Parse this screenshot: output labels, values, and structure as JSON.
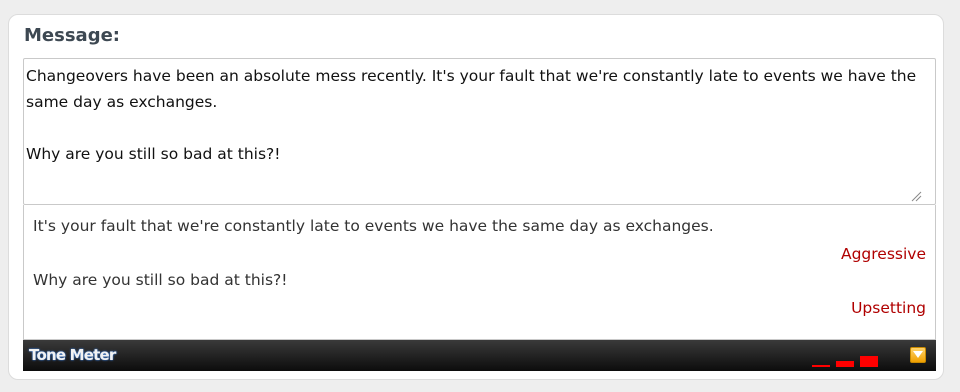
{
  "form": {
    "label": "Message:",
    "message_text": "Changeovers have been an absolute mess recently. It's your fault that we're constantly late to events we have the same day as exchanges.\n\nWhy are you still so bad at this?!"
  },
  "analysis": {
    "items": [
      {
        "sentence": "It's your fault that we're constantly late to events we have the same day as exchanges.",
        "tone": "Aggressive"
      },
      {
        "sentence": "Why are you still so bad at this?!",
        "tone": "Upsetting"
      }
    ],
    "tone_color": "#b00000"
  },
  "toolbar": {
    "brand": "Tone Meter",
    "meter_color": "#ff0000",
    "meter_levels": [
      0.2,
      0.5,
      0.9
    ],
    "expand_icon": "chevron-down-icon"
  }
}
